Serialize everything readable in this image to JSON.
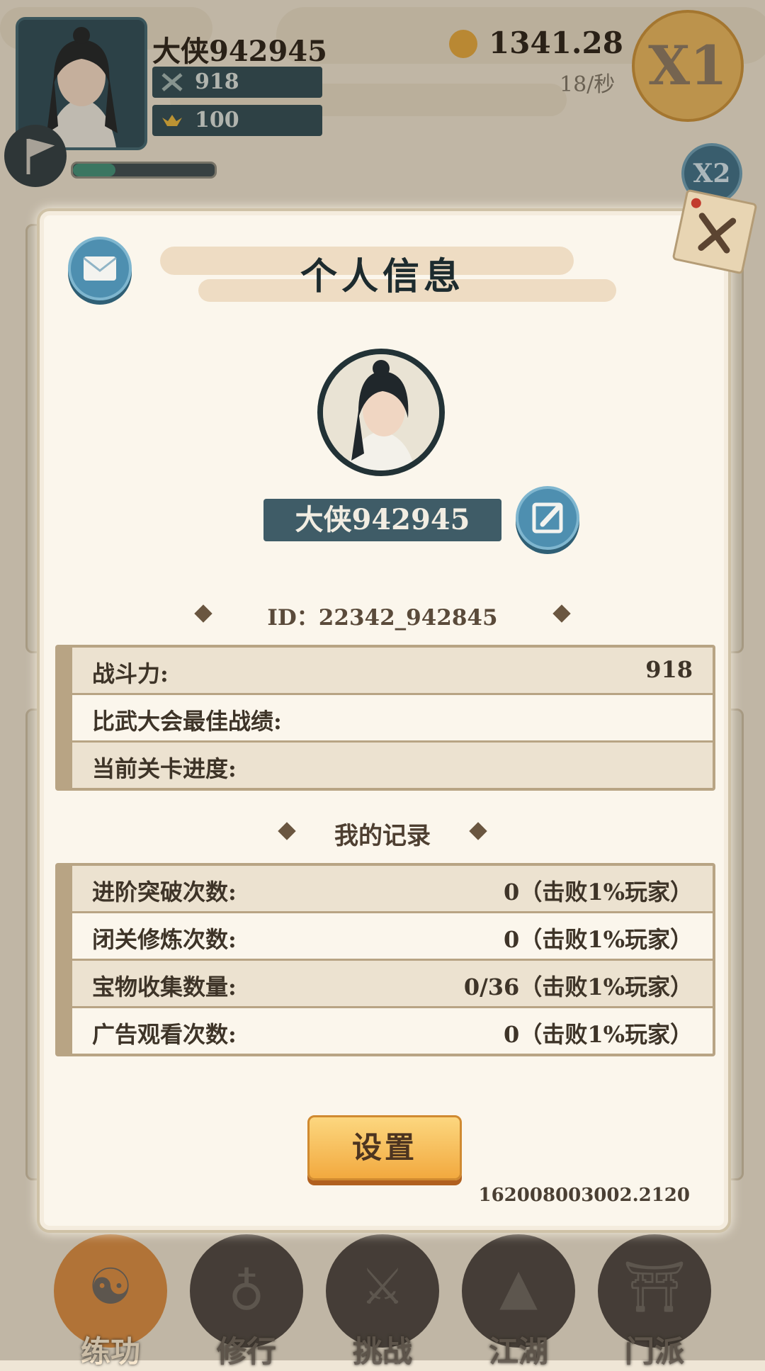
{
  "hud": {
    "player_name": "大侠942945",
    "combat_power": "918",
    "gold_ingots": "100",
    "coins": "1341.28",
    "coin_rate": "18/秒",
    "speed_x1": "X1",
    "speed_x2": "X2"
  },
  "modal": {
    "title": "个人信息",
    "player_name": "大侠942945",
    "id_line": "ID：22342_942845",
    "stats": [
      {
        "label": "战斗力:",
        "value": "918"
      },
      {
        "label": "比武大会最佳战绩:",
        "value": ""
      },
      {
        "label": "当前关卡进度:",
        "value": ""
      }
    ],
    "records_title": "我的记录",
    "records": [
      {
        "label": "进阶突破次数:",
        "value": "0（击败1%玩家）"
      },
      {
        "label": "闭关修炼次数:",
        "value": "0（击败1%玩家）"
      },
      {
        "label": "宝物收集数量:",
        "value": "0/36（击败1%玩家）"
      },
      {
        "label": "广告观看次数:",
        "value": "0（击败1%玩家）"
      }
    ],
    "settings_label": "设置",
    "version": "162008003002.2120"
  },
  "nav": [
    {
      "label": "练功",
      "icon": "martial-artist-icon",
      "active": true
    },
    {
      "label": "修行",
      "icon": "meditation-icon",
      "active": false
    },
    {
      "label": "挑战",
      "icon": "crossed-swords-icon",
      "active": false
    },
    {
      "label": "江湖",
      "icon": "mountain-icon",
      "active": false
    },
    {
      "label": "门派",
      "icon": "gate-icon",
      "active": false
    }
  ],
  "colors": {
    "panel": "#fbf6ec",
    "accent_blue": "#4e8fb0",
    "button_orange": "#f2a93f",
    "name_box": "#3f5c67"
  }
}
